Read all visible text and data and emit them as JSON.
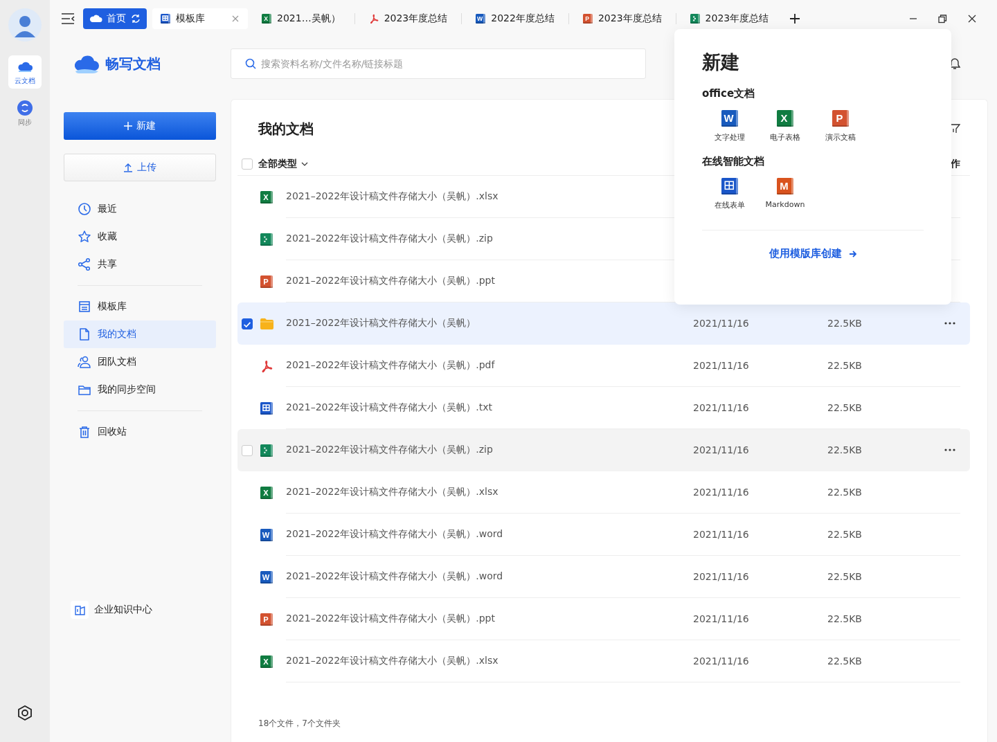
{
  "rail": {
    "items": [
      {
        "label": "云文档",
        "selected": true
      },
      {
        "label": "同步",
        "selected": false
      }
    ]
  },
  "tabs": [
    {
      "kind": "home",
      "label": "首页",
      "selected": false
    },
    {
      "kind": "template",
      "label": "模板库",
      "selected": true
    },
    {
      "kind": "xlsx",
      "label": "2021…吴帆）",
      "icon_text": "X",
      "selected": false
    },
    {
      "kind": "pdf",
      "label": "2023年度总结",
      "selected": false
    },
    {
      "kind": "word",
      "label": "2022年度总结",
      "icon_text": "W",
      "selected": false
    },
    {
      "kind": "ppt",
      "label": "2023年度总结",
      "icon_text": "P",
      "selected": false
    },
    {
      "kind": "zip",
      "label": "2023年度总结",
      "selected": false
    }
  ],
  "sidebar": {
    "logo": "畅写文档",
    "new_button": "新建",
    "upload_button": "上传",
    "groups": [
      {
        "items": [
          {
            "label": "最近",
            "selected": false
          },
          {
            "label": "收藏",
            "selected": false
          },
          {
            "label": "共享",
            "selected": false
          }
        ]
      },
      {
        "items": [
          {
            "label": "模板库",
            "selected": false
          },
          {
            "label": "我的文档",
            "selected": true
          },
          {
            "label": "团队文档",
            "selected": false
          },
          {
            "label": "我的同步空间",
            "selected": false
          }
        ]
      },
      {
        "items": [
          {
            "label": "回收站",
            "selected": false
          }
        ]
      }
    ],
    "enterprise": "企业知识中心"
  },
  "search": {
    "placeholder": "搜索资料名称/文件名称/链接标题"
  },
  "documents": {
    "title": "我的文档",
    "type_filter": "全部类型",
    "all_checked": false,
    "header_column_4": "作",
    "rows": [
      {
        "kind": "xlsx",
        "icon_text": "X",
        "name": "2021–2022年设计稿文件存储大小（吴帆）.xlsx",
        "selected": false,
        "hovered": false
      },
      {
        "kind": "zip",
        "name": "2021–2022年设计稿文件存储大小（吴帆）.zip",
        "selected": false,
        "hovered": false
      },
      {
        "kind": "ppt",
        "icon_text": "P",
        "name": "2021–2022年设计稿文件存储大小（吴帆）.ppt",
        "selected": false,
        "hovered": false
      },
      {
        "kind": "folder",
        "name": "2021–2022年设计稿文件存储大小（吴帆）",
        "date": "2021/11/16",
        "size": "22.5KB",
        "selected": true,
        "hovered": false
      },
      {
        "kind": "pdf",
        "name": "2021–2022年设计稿文件存储大小（吴帆）.pdf",
        "date": "2021/11/16",
        "size": "22.5KB",
        "selected": false,
        "hovered": false
      },
      {
        "kind": "form",
        "name": "2021–2022年设计稿文件存储大小（吴帆）.txt",
        "date": "2021/11/16",
        "size": "22.5KB",
        "selected": false,
        "hovered": false
      },
      {
        "kind": "zip",
        "name": "2021–2022年设计稿文件存储大小（吴帆）.zip",
        "date": "2021/11/16",
        "size": "22.5KB",
        "selected": false,
        "hovered": true
      },
      {
        "kind": "xlsx",
        "icon_text": "X",
        "name": "2021–2022年设计稿文件存储大小（吴帆）.xlsx",
        "date": "2021/11/16",
        "size": "22.5KB",
        "selected": false,
        "hovered": false
      },
      {
        "kind": "word",
        "icon_text": "W",
        "name": "2021–2022年设计稿文件存储大小（吴帆）.word",
        "date": "2021/11/16",
        "size": "22.5KB",
        "selected": false,
        "hovered": false
      },
      {
        "kind": "word",
        "icon_text": "W",
        "name": "2021–2022年设计稿文件存储大小（吴帆）.word",
        "date": "2021/11/16",
        "size": "22.5KB",
        "selected": false,
        "hovered": false
      },
      {
        "kind": "ppt",
        "icon_text": "P",
        "name": "2021–2022年设计稿文件存储大小（吴帆）.ppt",
        "date": "2021/11/16",
        "size": "22.5KB",
        "selected": false,
        "hovered": false
      },
      {
        "kind": "xlsx",
        "icon_text": "X",
        "name": "2021–2022年设计稿文件存储大小（吴帆）.xlsx",
        "date": "2021/11/16",
        "size": "22.5KB",
        "selected": false,
        "hovered": false
      }
    ],
    "summary": "18个文件，7个文件夹"
  },
  "new_menu": {
    "title": "新建",
    "sections": [
      {
        "title": "office文档",
        "items": [
          {
            "kind": "word",
            "icon_text": "W",
            "label": "文字处理"
          },
          {
            "kind": "xlsx",
            "icon_text": "X",
            "label": "电子表格"
          },
          {
            "kind": "ppt",
            "icon_text": "P",
            "label": "演示文稿"
          }
        ]
      },
      {
        "title": "在线智能文档",
        "items": [
          {
            "kind": "form",
            "label": "在线表单"
          },
          {
            "kind": "markdown",
            "icon_text": "M",
            "label": "Markdown"
          }
        ]
      }
    ],
    "template_link": "使用模版库创建"
  }
}
